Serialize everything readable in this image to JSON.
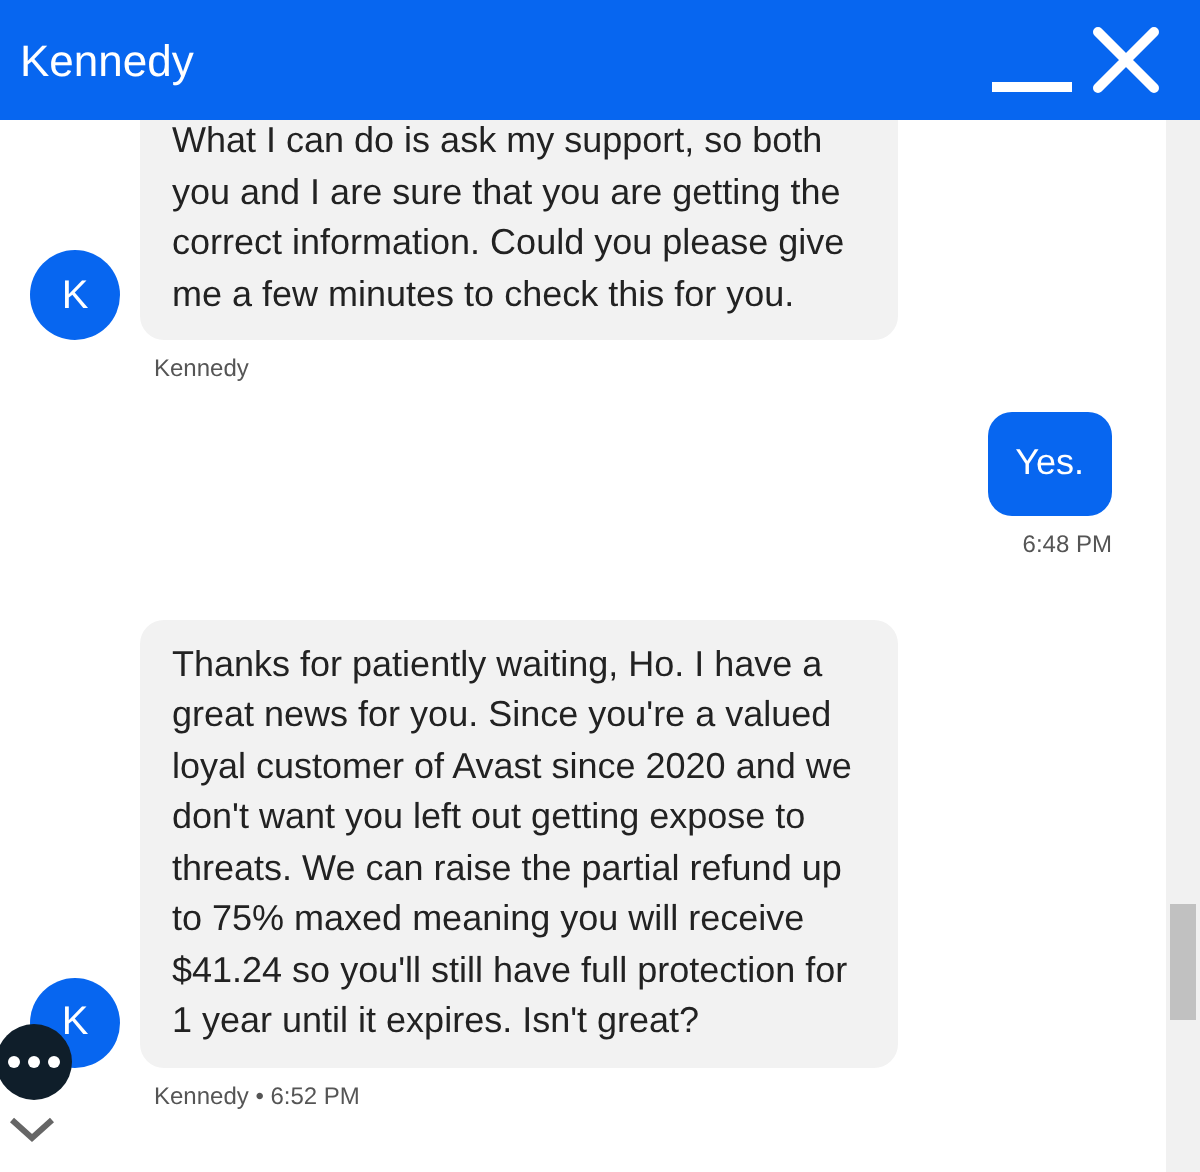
{
  "header": {
    "title": "Kennedy"
  },
  "messages": [
    {
      "kind": "agent",
      "avatar": "K",
      "text": "What I can do is ask my support, so both you and I are sure that you are getting the correct information. Could you please give me a few minutes to check this for you.",
      "meta": "Kennedy"
    },
    {
      "kind": "user",
      "text": "Yes.",
      "meta": "6:48 PM"
    },
    {
      "kind": "agent",
      "avatar": "K",
      "text": "Thanks for patiently waiting, Ho. I have a great news for you. Since you're a valued loyal customer of Avast since 2020 and we don't want you left out getting expose to threats. We can raise the partial refund up to 75% maxed meaning you will receive $41.24 so you'll still have full protection for 1 year until it expires. Isn't great?",
      "meta": "Kennedy • 6:52 PM"
    }
  ]
}
